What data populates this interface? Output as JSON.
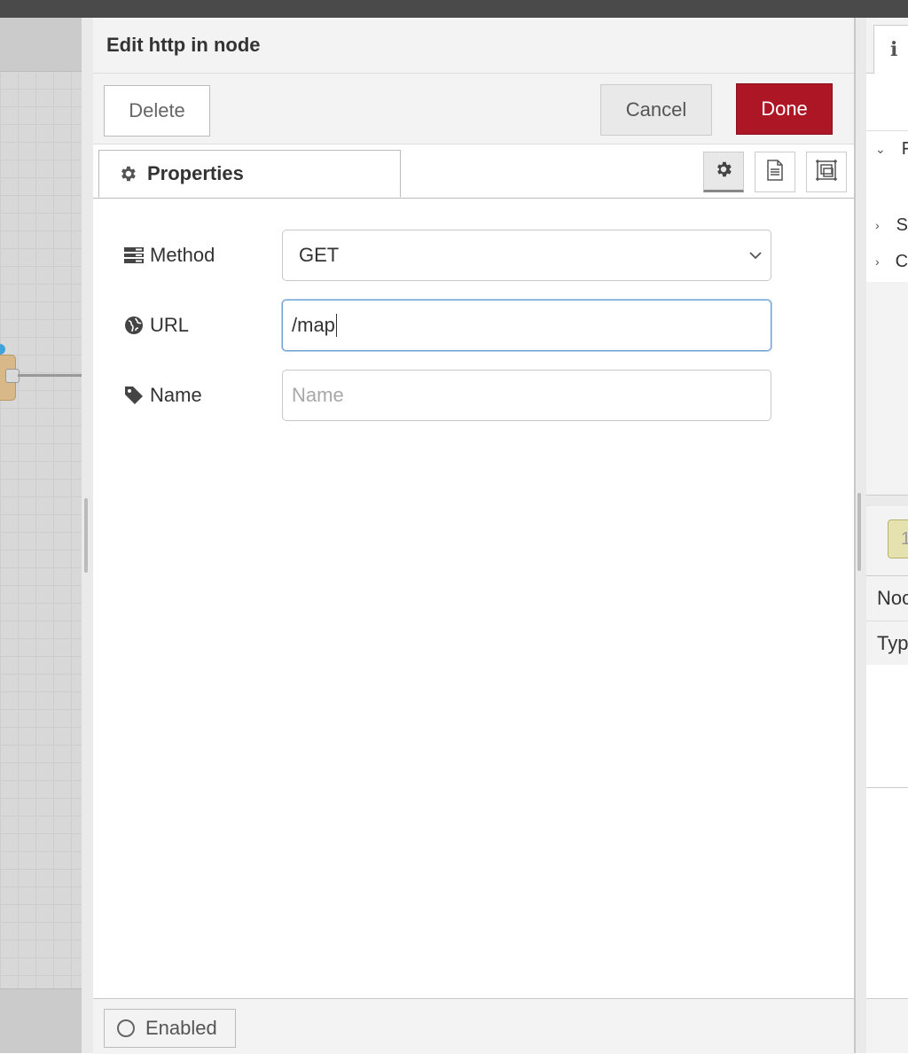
{
  "dialog": {
    "title": "Edit http in node",
    "buttons": {
      "delete": "Delete",
      "cancel": "Cancel",
      "done": "Done"
    },
    "tabs": {
      "properties": "Properties"
    },
    "fields": {
      "method": {
        "label": "Method",
        "value": "GET"
      },
      "url": {
        "label": "URL",
        "value": "/map"
      },
      "name": {
        "label": "Name",
        "placeholder": "Name",
        "value": ""
      }
    },
    "footer": {
      "enabled": "Enabled"
    }
  },
  "sidebar": {
    "info_tab": "i",
    "tree": [
      "F",
      "S",
      "C"
    ],
    "chip": "1",
    "rows": [
      "Noc",
      "Typ"
    ]
  },
  "colors": {
    "done_button": "#ad1625",
    "accent_focus": "#6a9fd0",
    "node": "#d8b888"
  }
}
